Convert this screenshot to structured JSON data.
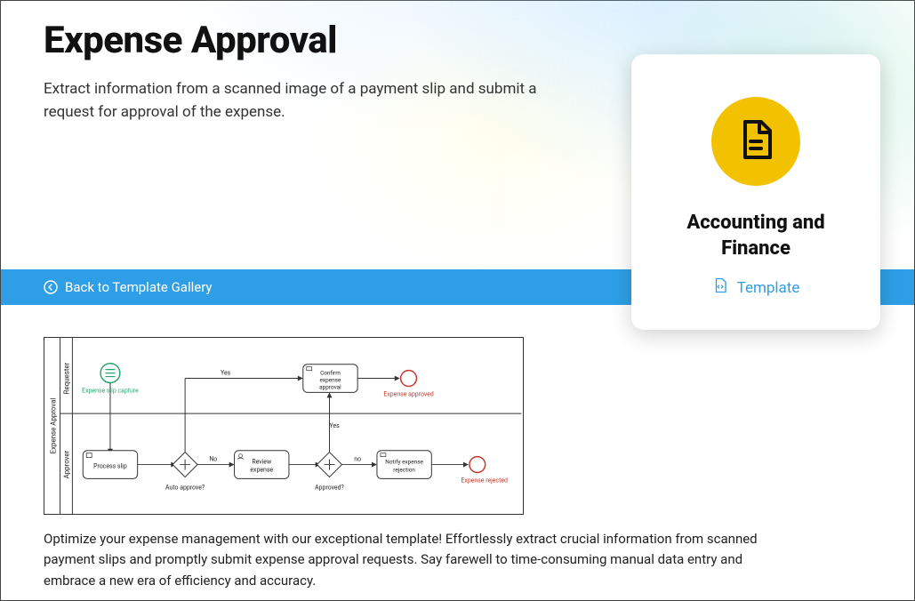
{
  "header": {
    "title": "Expense Approval",
    "subtitle": "Extract information from a scanned image of a payment slip and submit a request for approval of the expense."
  },
  "nav": {
    "back_label": "Back to Template Gallery"
  },
  "card": {
    "category": "Accounting and Finance",
    "link_label": "Template"
  },
  "diagram": {
    "title_vertical": "Expense Approval",
    "lanes": [
      "Requester",
      "Approver"
    ],
    "start_event": "Expense slip capture",
    "tasks": {
      "process_slip": "Process slip",
      "review_expense": "Review expense",
      "confirm_approval": "Confirm expense approval",
      "notify_rejection": "Notify expense rejection"
    },
    "gateways": {
      "auto_approve": "Auto approve?",
      "approved": "Approved?"
    },
    "edge_labels": {
      "yes1": "Yes",
      "no1": "No",
      "yes2": "Yes",
      "no2": "no"
    },
    "end_events": {
      "approved": "Expense approved",
      "rejected": "Expense rejected"
    }
  },
  "body": {
    "paragraph": "Optimize your expense management with our exceptional template! Effortlessly extract crucial information from scanned payment slips and promptly submit expense approval requests. Say farewell to time-consuming manual data entry and embrace a new era of efficiency and accuracy."
  }
}
